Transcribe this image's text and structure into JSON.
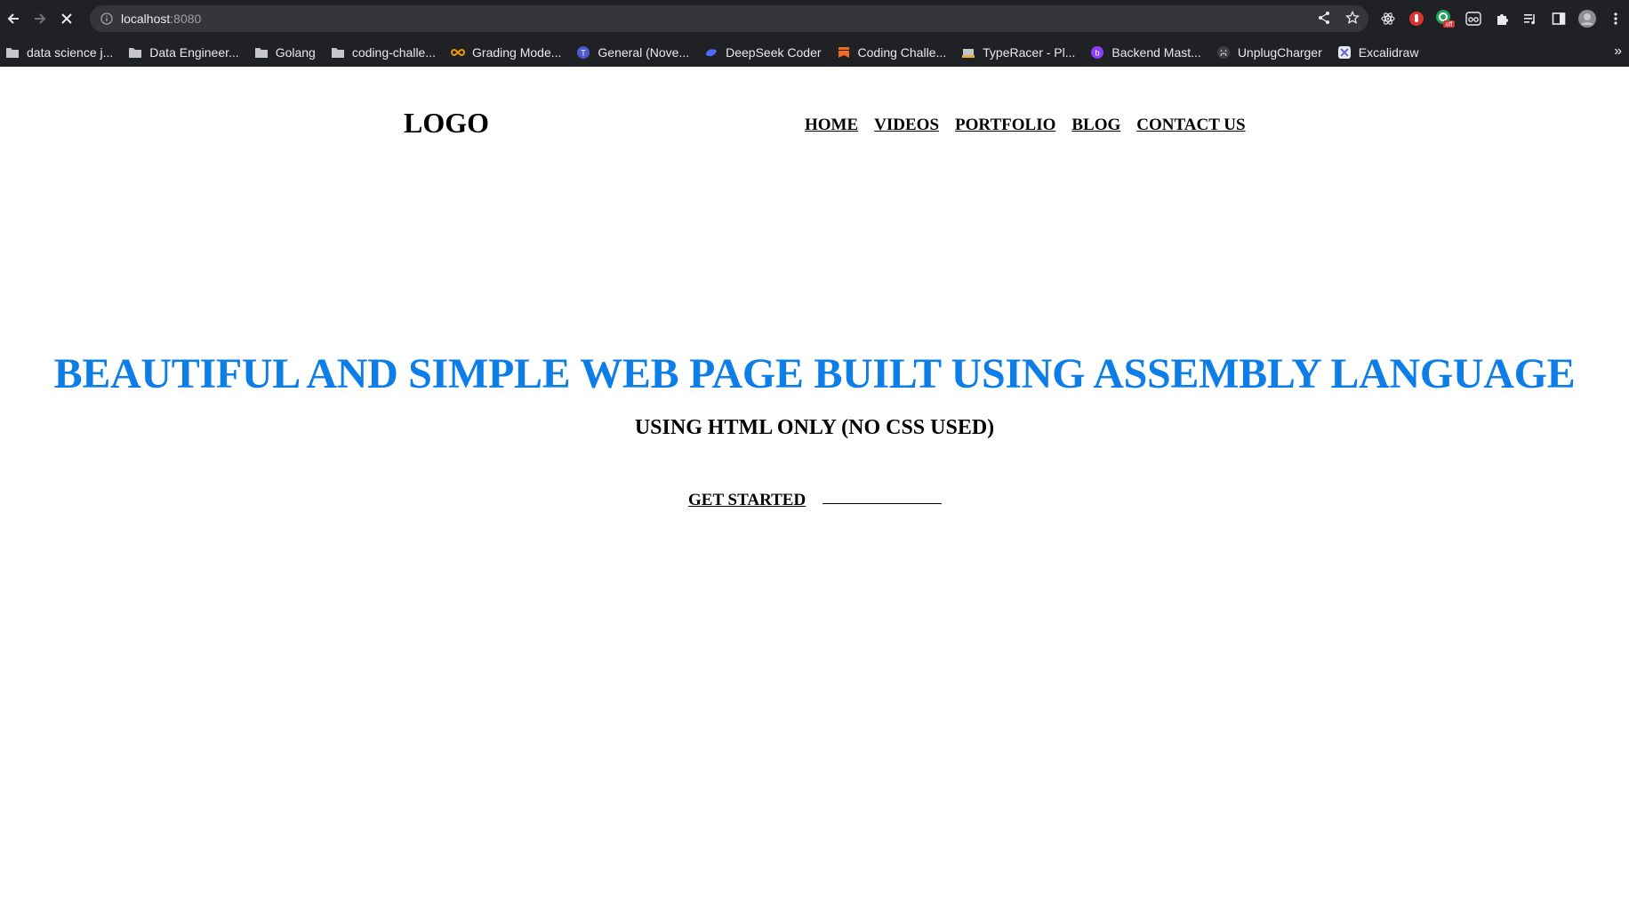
{
  "browser": {
    "url_host": "localhost",
    "url_port": ":8080",
    "bookmarks": [
      {
        "label": "data science j...",
        "icon": "folder-icon"
      },
      {
        "label": "Data Engineer...",
        "icon": "folder-icon"
      },
      {
        "label": "Golang",
        "icon": "folder-icon"
      },
      {
        "label": "coding-challe...",
        "icon": "folder-icon"
      },
      {
        "label": "Grading Mode...",
        "icon": "infinity-icon"
      },
      {
        "label": "General (Nove...",
        "icon": "teams-icon"
      },
      {
        "label": "DeepSeek Coder",
        "icon": "deepseek-icon"
      },
      {
        "label": "Coding Challe...",
        "icon": "bookmark-flag-icon"
      },
      {
        "label": "TypeRacer - Pl...",
        "icon": "typeracer-icon"
      },
      {
        "label": "Backend Mast...",
        "icon": "backend-icon"
      },
      {
        "label": "UnplugCharger",
        "icon": "github-icon"
      },
      {
        "label": "Excalidraw",
        "icon": "excalidraw-icon"
      }
    ],
    "more_label": "»"
  },
  "page": {
    "logo": "LOGO",
    "nav": [
      "HOME",
      "VIDEOS",
      "PORTFOLIO",
      "BLOG",
      "CONTACT US"
    ],
    "hero_title": "BEAUTIFUL AND SIMPLE WEB PAGE BUILT USING ASSEMBLY LANGUAGE",
    "hero_subtitle": "USING HTML ONLY (NO CSS USED)",
    "cta": "GET STARTED"
  },
  "colors": {
    "chrome_bg": "#202124",
    "omnibox_bg": "#35363a",
    "hero_title": "#0d7ee8"
  }
}
